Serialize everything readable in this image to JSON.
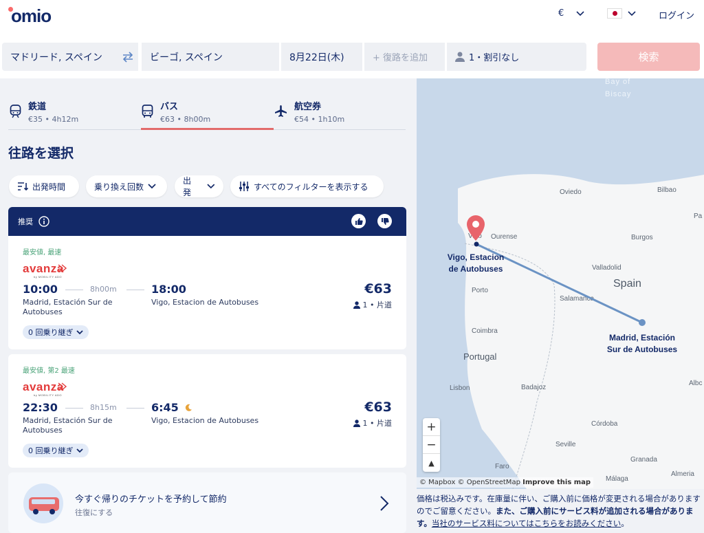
{
  "header": {
    "logo": "omio",
    "currency": "€",
    "login": "ログイン"
  },
  "search": {
    "from": "マドリード, スペイン",
    "to": "ビーゴ, スペイン",
    "date": "8月22日(木)",
    "return_placeholder": "+ 復路を追加",
    "passengers": "1・割引なし",
    "search_button": "検索"
  },
  "tabs": [
    {
      "label": "鉄道",
      "sub": "€35 • 4h12m",
      "icon": "train-icon"
    },
    {
      "label": "バス",
      "sub": "€63 • 8h00m",
      "icon": "bus-icon",
      "active": true
    },
    {
      "label": "航空券",
      "sub": "€54 • 1h10m",
      "icon": "plane-icon"
    }
  ],
  "page_title": "往路を選択",
  "filters": {
    "departure_time": "出発時間",
    "transfers": "乗り換え回数",
    "departure": "出発",
    "all_filters": "すべてのフィルターを表示する"
  },
  "recommended": {
    "label": "推奨"
  },
  "results": [
    {
      "tag": "最安値, 最速",
      "brand": "avanza",
      "brand_sub": "by MOBILITY ADO",
      "depart": "10:00",
      "duration": "8h00m",
      "arrive": "18:00",
      "from_station": "Madrid, Estación Sur de Autobuses",
      "to_station": "Vigo, Estacion de Autobuses",
      "price": "€63",
      "pax": "1 • 片道",
      "transfers": "0 回乗り継ぎ"
    },
    {
      "tag": "最安値, 第2 最速",
      "brand": "avanza",
      "brand_sub": "by MOBILITY ADO",
      "depart": "22:30",
      "duration": "8h15m",
      "arrive": "6:45",
      "from_station": "Madrid, Estación Sur de Autobuses",
      "to_station": "Vigo, Estacion de Autobuses",
      "price": "€63",
      "pax": "1 • 片道",
      "transfers": "0 回乗り継ぎ"
    }
  ],
  "promo": {
    "title": "今すぐ帰りのチケットを予約して節約",
    "subtitle": "往復にする"
  },
  "map": {
    "labels": {
      "bay": "Bay of",
      "bay2": "Biscay",
      "oviedo": "Oviedo",
      "bilbao": "Bilbao",
      "pa": "Pa",
      "vigo": "Vigo",
      "ourense": "Ourense",
      "burgos": "Burgos",
      "valladolid": "Valladolid",
      "spain": "Spain",
      "porto": "Porto",
      "salamanca": "Salamanca",
      "coimbra": "Coimbra",
      "portugal": "Portugal",
      "lisbon": "Lisbon",
      "badajoz": "Badajoz",
      "cordoba": "Córdoba",
      "seville": "Seville",
      "granada": "Granada",
      "malaga": "Málaga",
      "almeria": "Almeria",
      "faro": "Faro",
      "albc": "Albc"
    },
    "origin_label_1": "Madrid, Estación",
    "origin_label_2": "Sur de Autobuses",
    "dest_label_1": "Vigo, Estacion",
    "dest_label_2": "de Autobuses",
    "zoom_in": "+",
    "zoom_out": "−",
    "compass": "▲",
    "attribution": "© Mapbox © OpenStreetMap",
    "improve": "Improve this map"
  },
  "footer_note": {
    "text1": "価格は税込みです。在庫量に伴い、ご購入前に価格が変更される場合がありますのでご留意ください。",
    "bold": "また、ご購入前にサービス料が追加される場合があります。",
    "link": "当社のサービス料についてはこちらをお読みください",
    "end": "。"
  },
  "colors": {
    "navy": "#132968",
    "coral": "#fa6b6b",
    "search_disabled": "#f5baba",
    "route": "#6b93c4"
  }
}
